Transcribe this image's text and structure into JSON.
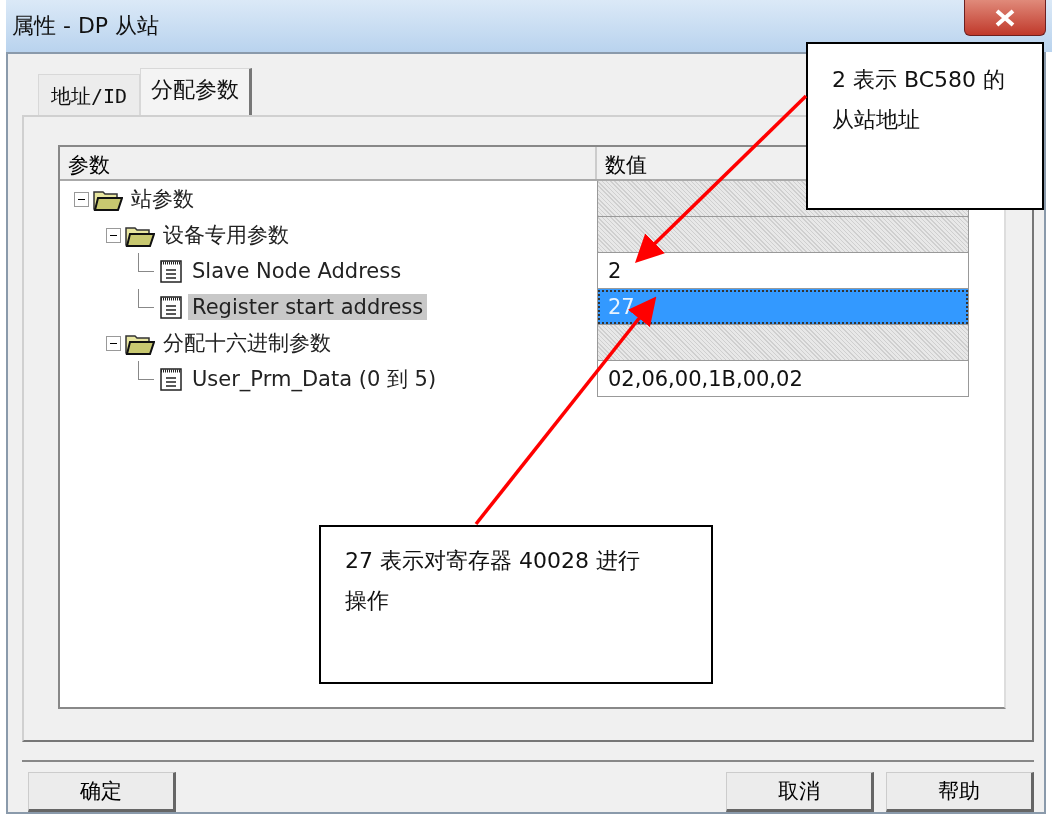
{
  "window": {
    "title": "属性 - DP 从站"
  },
  "tabs": [
    {
      "label": "地址/ID",
      "selected": false
    },
    {
      "label": "分配参数",
      "selected": true
    }
  ],
  "table": {
    "columns": [
      "参数",
      "数值"
    ],
    "rows": [
      {
        "kind": "folder",
        "label": "站参数",
        "expanded": true,
        "selected": false,
        "children": [
          {
            "kind": "folder",
            "label": "设备专用参数",
            "expanded": true,
            "selected": false,
            "children": [
              {
                "kind": "param",
                "label": "Slave Node Address",
                "value": "2",
                "selected": false
              },
              {
                "kind": "param",
                "label": "Register start address",
                "value": "27",
                "selected": true
              }
            ]
          },
          {
            "kind": "folder",
            "label": "分配十六进制参数",
            "expanded": true,
            "selected": false,
            "children": [
              {
                "kind": "param",
                "label": "User_Prm_Data (0 到 5)",
                "value": "02,06,00,1B,00,02",
                "selected": false
              }
            ]
          }
        ]
      }
    ]
  },
  "buttons": [
    {
      "label": "确定"
    },
    {
      "label": "取消"
    },
    {
      "label": "帮助"
    }
  ],
  "callouts": [
    {
      "text": "2 表示 BC580 的从站地址"
    },
    {
      "text": "27 表示对寄存器 40028 进行操作"
    }
  ]
}
